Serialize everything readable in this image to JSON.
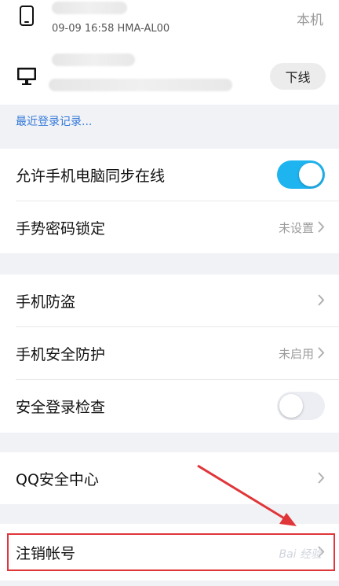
{
  "devices": [
    {
      "icon": "phone-icon",
      "meta": "09-09 16:58 HMA-AL00",
      "status": "本机"
    },
    {
      "icon": "desktop-icon",
      "action": "下线"
    }
  ],
  "recent_logins_link": "最近登录记录...",
  "settings_group1": [
    {
      "label": "允许手机电脑同步在线",
      "toggle": "on"
    },
    {
      "label": "手势密码锁定",
      "value": "未设置"
    }
  ],
  "settings_group2": [
    {
      "label": "手机防盗"
    },
    {
      "label": "手机安全防护",
      "value": "未启用"
    },
    {
      "label": "安全登录检查",
      "toggle": "off"
    }
  ],
  "settings_group3": [
    {
      "label": "QQ安全中心"
    }
  ],
  "settings_group4": [
    {
      "label": "注销帐号"
    }
  ],
  "colors": {
    "accent_toggle": "#1eb4f0",
    "link": "#3479d9",
    "annotation_red": "#e0363a",
    "background": "#f1f2f6"
  }
}
